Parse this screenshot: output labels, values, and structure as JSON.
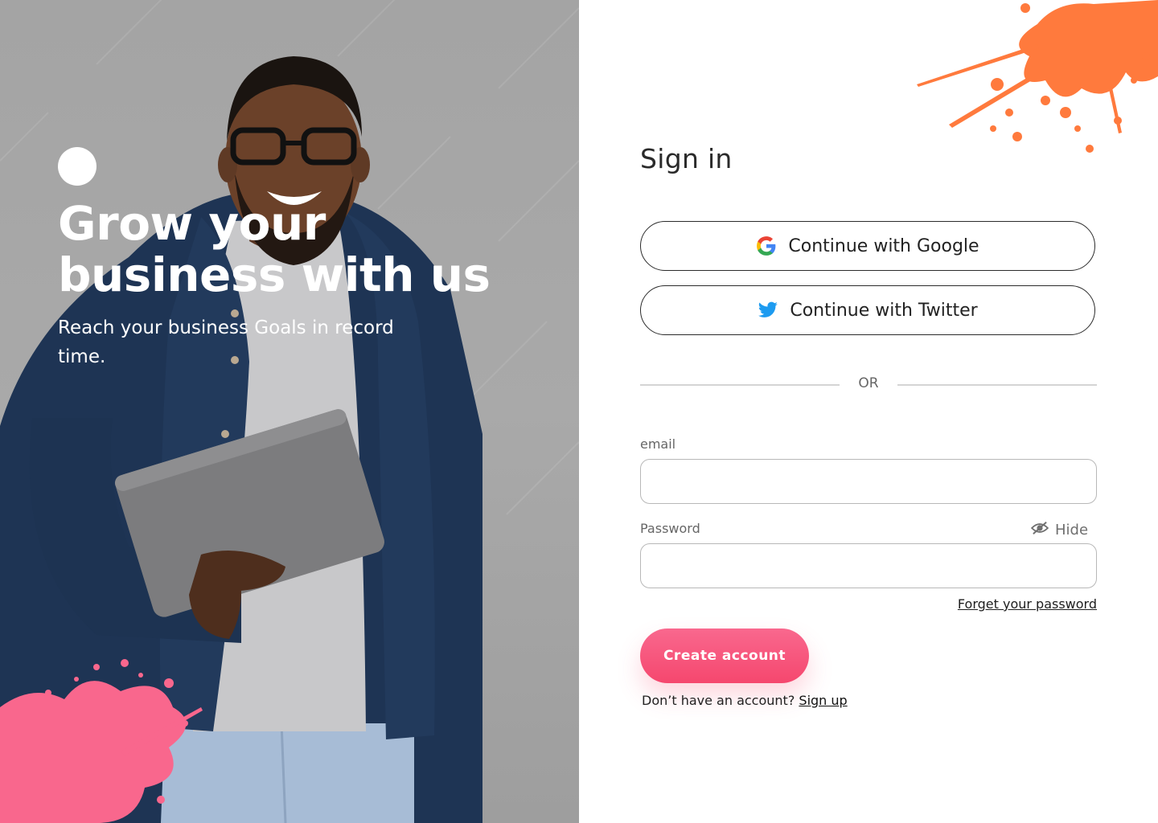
{
  "hero": {
    "title": "Grow your business with us",
    "subtitle": "Reach your business Goals in record time.",
    "photo_icon": "person-holding-laptop-photo",
    "accent_splash_color": "#f9678d"
  },
  "form": {
    "title": "Sign in",
    "google_button_label": "Continue with Google",
    "twitter_button_label": "Continue with Twitter",
    "divider_text": "OR",
    "email_label": "email",
    "email_value": "",
    "password_label": "Password",
    "password_value": "",
    "hide_label": "Hide",
    "forgot_password_label": "Forget your password",
    "create_account_label": "Create account",
    "signup_prompt": "Don’t have an account?",
    "signup_link_label": "Sign up"
  },
  "colors": {
    "primary_button": "#f5476e",
    "splash_orange": "#ff7a3d",
    "twitter_blue": "#1d9bf0"
  },
  "icons": {
    "google": "google-icon",
    "twitter": "twitter-icon",
    "hide": "eye-slash-icon"
  }
}
